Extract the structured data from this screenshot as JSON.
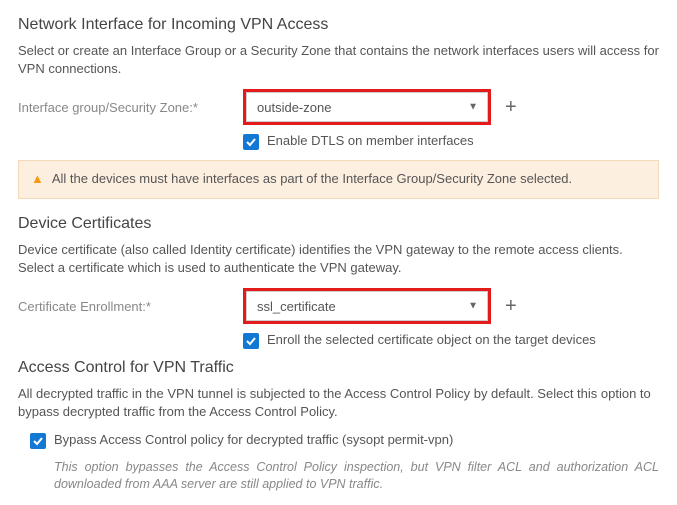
{
  "network_interface": {
    "heading": "Network Interface for Incoming VPN Access",
    "desc": "Select or create an Interface Group or a Security Zone that contains the network interfaces users will access for VPN connections.",
    "field_label": "Interface group/Security Zone:*",
    "zone_value": "outside-zone",
    "dtls_label": "Enable DTLS on member interfaces",
    "alert": "All the devices must have interfaces as part of the Interface Group/Security Zone selected."
  },
  "device_certs": {
    "heading": "Device Certificates",
    "desc": "Device certificate (also called Identity certificate) identifies the VPN gateway to the remote access clients. Select a certificate which is used to authenticate the VPN gateway.",
    "field_label": "Certificate Enrollment:*",
    "cert_value": "ssl_certificate",
    "enroll_label": "Enroll the selected certificate object on the target devices"
  },
  "access_control": {
    "heading": "Access Control for VPN Traffic",
    "desc": "All decrypted traffic in the VPN tunnel is subjected to the Access Control Policy by default. Select this option to bypass decrypted traffic from the Access Control Policy.",
    "bypass_label": "Bypass Access Control policy for decrypted traffic (sysopt permit-vpn)",
    "bypass_note": "This option bypasses the Access Control Policy inspection, but VPN filter ACL and authorization ACL downloaded from AAA server are still applied to VPN traffic."
  }
}
